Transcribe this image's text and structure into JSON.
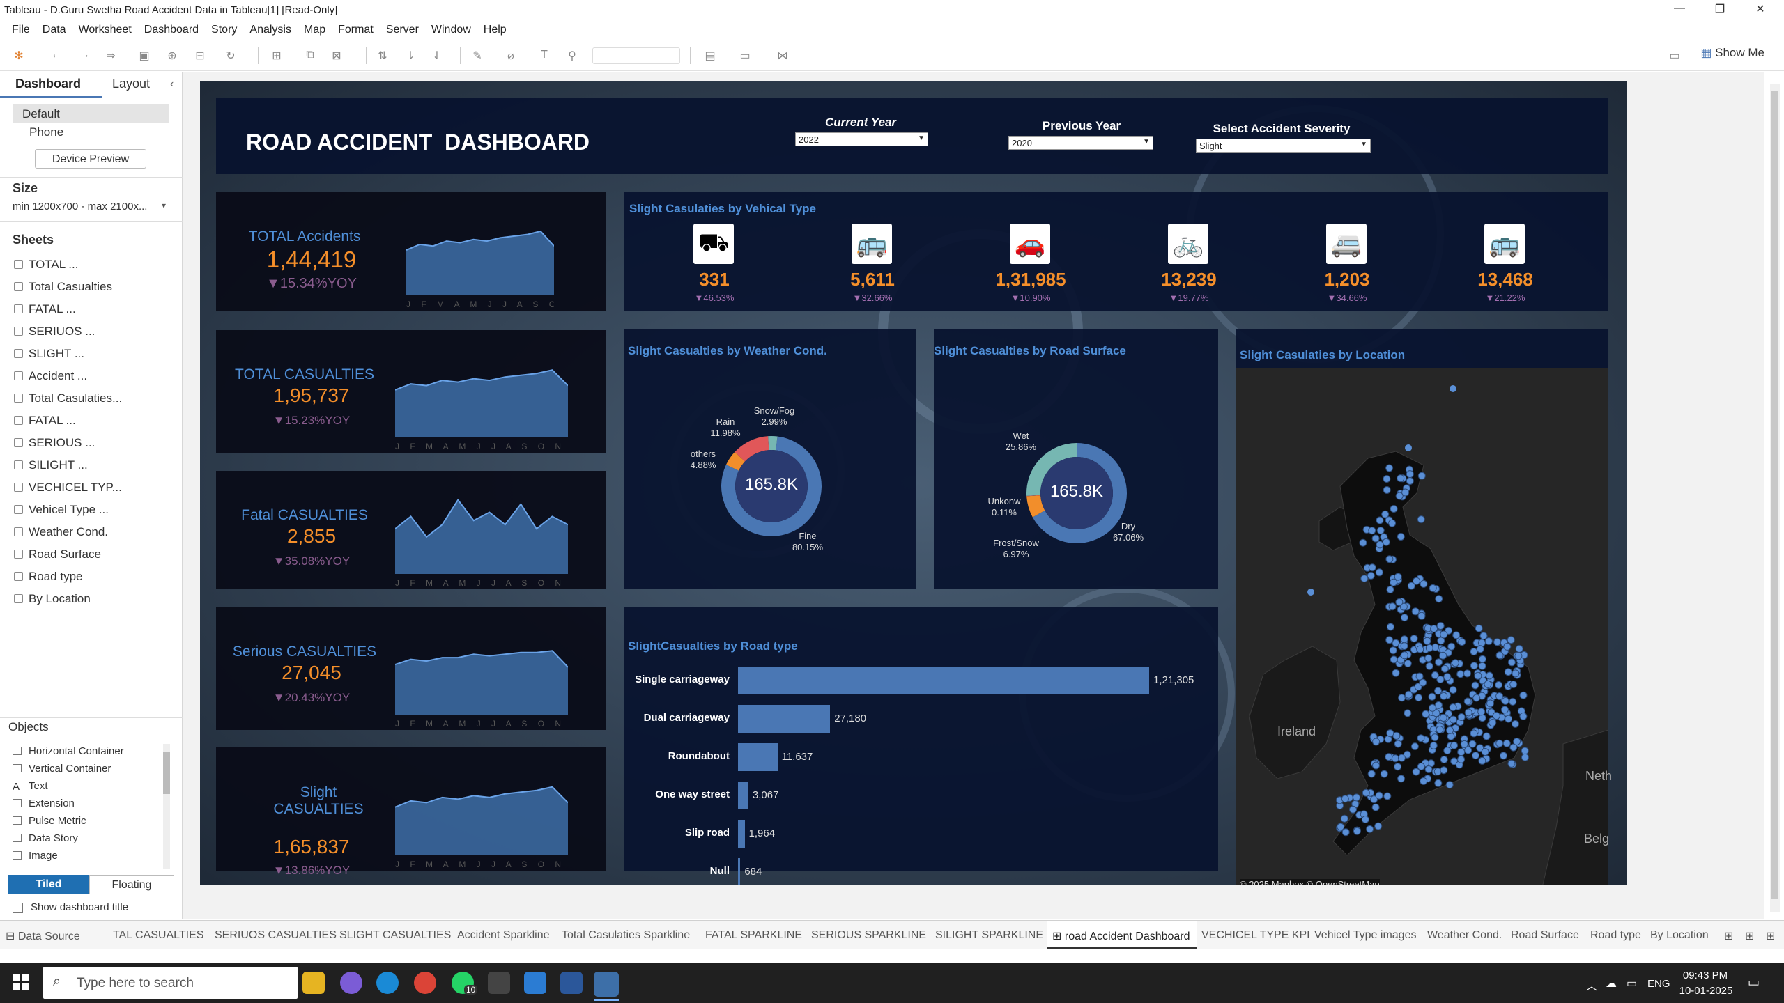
{
  "window": {
    "title": "Tableau - D.Guru Swetha Road Accident Data in Tableau[1] [Read-Only]"
  },
  "menu": [
    "File",
    "Data",
    "Worksheet",
    "Dashboard",
    "Story",
    "Analysis",
    "Map",
    "Format",
    "Server",
    "Window",
    "Help"
  ],
  "toolbar": {
    "show_me": "Show Me"
  },
  "left_pane": {
    "tabs": {
      "dashboard": "Dashboard",
      "layout": "Layout"
    },
    "devices": {
      "default": "Default",
      "phone": "Phone",
      "preview_button": "Device Preview"
    },
    "size": {
      "label": "Size",
      "value": "min 1200x700 - max 2100x..."
    },
    "sheets_label": "Sheets",
    "sheets": [
      "TOTAL ...",
      "Total Casualties",
      "FATAL ...",
      "SERIUOS ...",
      "SLIGHT ...",
      "Accident ...",
      "Total Casulaties...",
      "FATAL ...",
      "SERIOUS ...",
      "SILIGHT ...",
      "VECHICEL TYP...",
      "Vehicel Type ...",
      "Weather Cond.",
      "Road Surface",
      "Road type",
      "By Location"
    ],
    "objects_label": "Objects",
    "objects": [
      "Horizontal Container",
      "Vertical Container",
      "Text",
      "Extension",
      "Pulse Metric",
      "Data Story",
      "Image"
    ],
    "tiled": "Tiled",
    "floating": "Floating",
    "show_title": "Show dashboard title"
  },
  "dashboard": {
    "title": "ROAD ACCIDENT  DASHBOARD",
    "filters": {
      "current_year": {
        "label": "Current Year",
        "value": "2022"
      },
      "previous_year": {
        "label": "Previous Year",
        "value": "2020"
      },
      "severity": {
        "label": "Select Accident Severity",
        "value": "Slight"
      }
    },
    "kpis": [
      {
        "label": "TOTAL Accidents",
        "value": "1,44,419",
        "yoy": "▼15.34%YOY",
        "axis": "J F M A M J J A S O N D",
        "spark": [
          0.55,
          0.62,
          0.6,
          0.66,
          0.64,
          0.68,
          0.66,
          0.7,
          0.72,
          0.74,
          0.78,
          0.6
        ]
      },
      {
        "label": "TOTAL CASUALTIES",
        "value": "1,95,737",
        "yoy": "▼15.23%YOY",
        "axis": "J F M A M J J A S O N D",
        "spark": [
          0.55,
          0.62,
          0.6,
          0.66,
          0.64,
          0.68,
          0.66,
          0.7,
          0.72,
          0.74,
          0.78,
          0.6
        ]
      },
      {
        "label": "Fatal CASUALTIES",
        "value": "2,855",
        "yoy": "▼35.08%YOY",
        "axis": "J F M A M J J A S O N D",
        "spark": [
          0.55,
          0.7,
          0.45,
          0.6,
          0.9,
          0.65,
          0.75,
          0.6,
          0.85,
          0.55,
          0.7,
          0.6
        ]
      },
      {
        "label": "Serious CASUALTIES",
        "value": "27,045",
        "yoy": "▼20.43%YOY",
        "axis": "J F M A M J J A S O N D",
        "spark": [
          0.58,
          0.64,
          0.62,
          0.66,
          0.66,
          0.7,
          0.68,
          0.7,
          0.72,
          0.72,
          0.74,
          0.55
        ]
      },
      {
        "label": "Slight CASUALTIES",
        "value": "1,65,837",
        "yoy": "▼13.86%YOY",
        "axis": "J F M A M J J A S O N D",
        "spark": [
          0.55,
          0.62,
          0.6,
          0.66,
          0.64,
          0.68,
          0.66,
          0.7,
          0.72,
          0.74,
          0.78,
          0.6
        ]
      }
    ],
    "vehicle": {
      "title": "Slight Casulaties by Vehical Type",
      "items": [
        {
          "icon": "agri-vehicle-icon",
          "value": "331",
          "yoy": "▼46.53%"
        },
        {
          "icon": "bus-icon",
          "value": "5,611",
          "yoy": "▼32.66%"
        },
        {
          "icon": "car-icon",
          "value": "1,31,985",
          "yoy": "▼10.90%"
        },
        {
          "icon": "bicycle-icon",
          "value": "13,239",
          "yoy": "▼19.77%"
        },
        {
          "icon": "van-icon",
          "value": "1,203",
          "yoy": "▼34.66%"
        },
        {
          "icon": "bus-icon",
          "value": "13,468",
          "yoy": "▼21.22%"
        }
      ]
    },
    "weather": {
      "title": "Slight Casualties by Weather Cond.",
      "center": "165.8K",
      "slices": [
        {
          "name": "Fine",
          "pct": "80.15%",
          "share": 0.8015,
          "color": "#4a77b4"
        },
        {
          "name": "others",
          "pct": "4.88%",
          "share": 0.0488,
          "color": "#f28e2b"
        },
        {
          "name": "Rain",
          "pct": "11.98%",
          "share": 0.1198,
          "color": "#e15759"
        },
        {
          "name": "Snow/Fog",
          "pct": "2.99%",
          "share": 0.0299,
          "color": "#76b7b2"
        }
      ]
    },
    "surface": {
      "title": "Slight Casualties by Road Surface",
      "center": "165.8K",
      "slices": [
        {
          "name": "Dry",
          "pct": "67.06%",
          "share": 0.6706,
          "color": "#4a77b4"
        },
        {
          "name": "Frost/Snow",
          "pct": "6.97%",
          "share": 0.0697,
          "color": "#f28e2b"
        },
        {
          "name": "Unkonw",
          "pct": "0.11%",
          "share": 0.0011,
          "color": "#e15759"
        },
        {
          "name": "Wet",
          "pct": "25.86%",
          "share": 0.2586,
          "color": "#76b7b2"
        }
      ]
    },
    "road_type": {
      "title": "SlightCasualties by Road type",
      "bars": [
        {
          "name": "Single carriageway",
          "label": "1,21,305",
          "value": 121305
        },
        {
          "name": "Dual carriageway",
          "label": "27,180",
          "value": 27180
        },
        {
          "name": "Roundabout",
          "label": "11,637",
          "value": 11637
        },
        {
          "name": "One way street",
          "label": "3,067",
          "value": 3067
        },
        {
          "name": "Slip road",
          "label": "1,964",
          "value": 1964
        },
        {
          "name": "Null",
          "label": "684",
          "value": 684
        }
      ]
    },
    "location": {
      "title": "Slight Casulaties by Location",
      "labels": {
        "ireland": "Ireland",
        "neth": "Neth",
        "belg": "Belg"
      },
      "credit": "© 2025 Mapbox © OpenStreetMap"
    }
  },
  "sheet_tabs": [
    "Data Source",
    "TAL CASUALTIES",
    "SERIUOS CASUALTIES",
    "SLIGHT CASUALTIES",
    "Accident Sparkline",
    "Total Casulaties Sparkline",
    "FATAL SPARKLINE",
    "SERIOUS  SPARKLINE",
    "SILIGHT SPARKLINE",
    "road Accident Dashboard",
    "VECHICEL TYPE KPI",
    "Vehicel Type images",
    "Weather Cond.",
    "Road Surface",
    "Road type",
    "By Location"
  ],
  "taskbar": {
    "search_placeholder": "Type here to search",
    "lang": "ENG",
    "time": "09:43 PM",
    "date": "10-01-2025",
    "badge": "10"
  }
}
